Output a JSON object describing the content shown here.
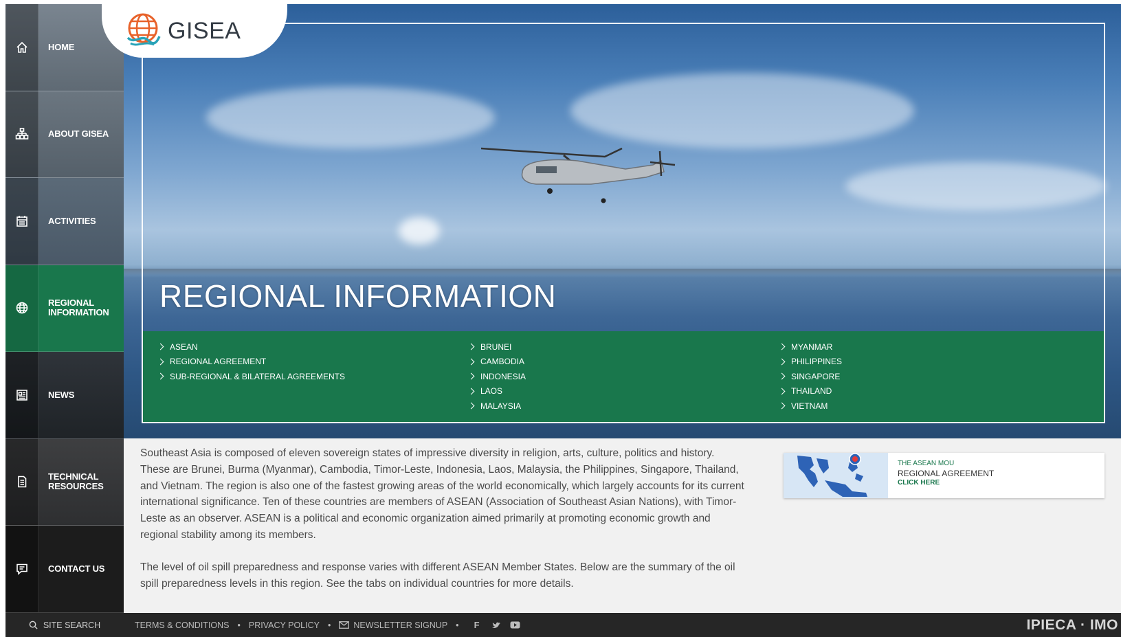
{
  "brand": {
    "name": "GISEA"
  },
  "nav": [
    {
      "id": "home",
      "label": "HOME",
      "icon": "home-icon"
    },
    {
      "id": "about",
      "label": "ABOUT GISEA",
      "icon": "sitemap-icon"
    },
    {
      "id": "activities",
      "label": "ACTIVITIES",
      "icon": "calendar-icon"
    },
    {
      "id": "regional",
      "label": "REGIONAL INFORMATION",
      "icon": "globe-icon",
      "active": true
    },
    {
      "id": "news",
      "label": "NEWS",
      "icon": "newspaper-icon"
    },
    {
      "id": "technical",
      "label": "TECHNICAL RESOURCES",
      "icon": "document-icon"
    },
    {
      "id": "contact",
      "label": "CONTACT US",
      "icon": "chat-icon"
    }
  ],
  "hero": {
    "title": "REGIONAL INFORMATION",
    "columns": [
      [
        "ASEAN",
        "REGIONAL AGREEMENT",
        "SUB-REGIONAL & BILATERAL AGREEMENTS"
      ],
      [
        "BRUNEI",
        "CAMBODIA",
        "INDONESIA",
        "LAOS",
        "MALAYSIA"
      ],
      [
        "MYANMAR",
        "PHILIPPINES",
        "SINGAPORE",
        "THAILAND",
        "VIETNAM"
      ]
    ]
  },
  "content": {
    "paragraph1": "Southeast Asia is composed of eleven sovereign states of impressive diversity in religion, arts, culture, politics and history. These are Brunei, Burma (Myanmar), Cambodia, Timor-Leste, Indonesia, Laos, Malaysia, the Philippines, Singapore, Thailand, and Vietnam. The region is also one of the fastest growing areas of the world economically, which largely accounts for its current international significance. Ten of these countries are members of ASEAN (Association of Southeast Asian Nations), with Timor-Leste as an observer. ASEAN is a political and economic organization aimed primarily at promoting economic growth and regional stability among its members.",
    "paragraph2": "The level of oil spill preparedness and response varies with different ASEAN Member States. Below are the summary of the oil spill preparedness levels in this region. See the tabs on individual countries for more details."
  },
  "promo": {
    "kicker": "THE ASEAN MOU",
    "title": "REGIONAL AGREEMENT",
    "cta": "CLICK HERE"
  },
  "footer": {
    "search_label": "SITE SEARCH",
    "terms": "TERMS & CONDITIONS",
    "privacy": "PRIVACY POLICY",
    "newsletter": "NEWSLETTER SIGNUP",
    "partners": "IPIECA · IMO"
  },
  "colors": {
    "accent": "#19774c",
    "footer": "#262626"
  }
}
